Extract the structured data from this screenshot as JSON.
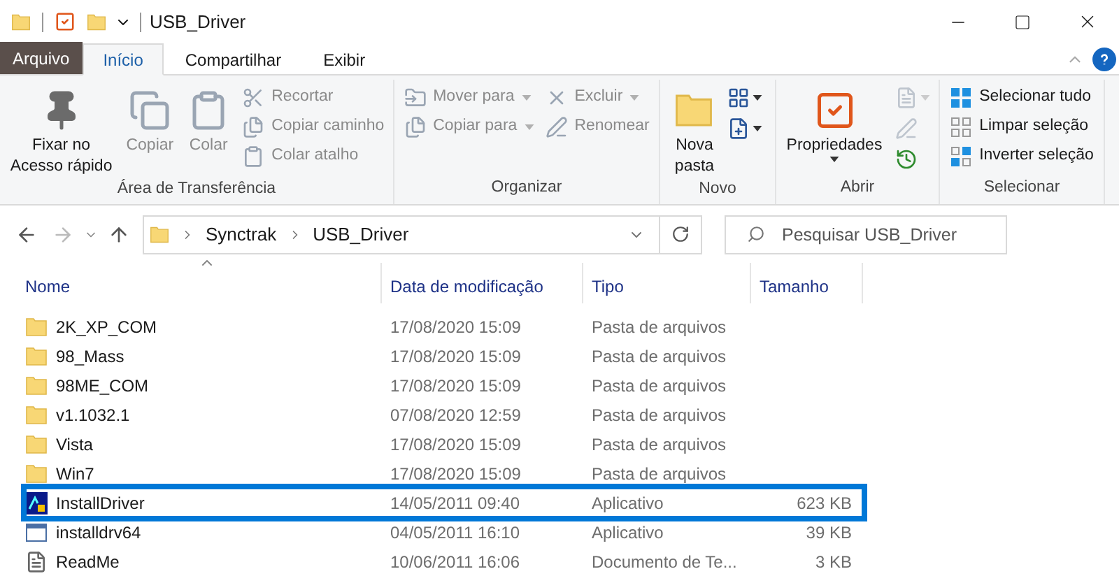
{
  "title_bar": {
    "title": "USB_Driver"
  },
  "ribbon_tabs": [
    {
      "label": "Arquivo",
      "kind": "file",
      "selected": false
    },
    {
      "label": "Início",
      "kind": "tab",
      "selected": true
    },
    {
      "label": "Compartilhar",
      "kind": "tab",
      "selected": false
    },
    {
      "label": "Exibir",
      "kind": "tab",
      "selected": false
    }
  ],
  "ribbon_groups": [
    {
      "label": "Área de Transferência",
      "columns": [
        [
          {
            "kind": "large",
            "label": "Fixar no\nAcesso rápido",
            "disabled": false
          }
        ],
        [
          {
            "kind": "large",
            "label": "Copiar",
            "disabled": true
          }
        ],
        [
          {
            "kind": "large",
            "label": "Colar",
            "disabled": true
          }
        ],
        [
          {
            "kind": "small",
            "label": "Recortar",
            "disabled": true
          },
          {
            "kind": "small",
            "label": "Copiar caminho",
            "disabled": true
          },
          {
            "kind": "small",
            "label": "Colar atalho",
            "disabled": true
          }
        ]
      ]
    },
    {
      "label": "Organizar",
      "columns": [
        [
          {
            "kind": "small",
            "label": "Mover para",
            "disabled": true,
            "dropdown": true
          },
          {
            "kind": "small",
            "label": "Copiar para",
            "disabled": true,
            "dropdown": true
          }
        ],
        [
          {
            "kind": "small",
            "label": "Excluir",
            "disabled": true,
            "dropdown": true
          },
          {
            "kind": "small",
            "label": "Renomear",
            "disabled": true
          }
        ]
      ]
    },
    {
      "label": "Novo",
      "columns": [
        [
          {
            "kind": "large",
            "label": "Nova\npasta",
            "disabled": false
          }
        ],
        [
          {
            "kind": "icon",
            "disabled": false,
            "dropdown": true
          },
          {
            "kind": "icon",
            "disabled": false,
            "dropdown": true
          }
        ]
      ]
    },
    {
      "label": "Abrir",
      "columns": [
        [
          {
            "kind": "large",
            "label": "Propriedades",
            "disabled": false,
            "dropdown": true
          }
        ],
        [
          {
            "kind": "icon",
            "disabled": true,
            "dropdown": true
          },
          {
            "kind": "icon",
            "disabled": true
          },
          {
            "kind": "icon",
            "disabled": false
          }
        ]
      ]
    },
    {
      "label": "Selecionar",
      "columns": [
        [
          {
            "kind": "small",
            "label": "Selecionar tudo",
            "disabled": false
          },
          {
            "kind": "small",
            "label": "Limpar seleção",
            "disabled": false
          },
          {
            "kind": "small",
            "label": "Inverter seleção",
            "disabled": false
          }
        ]
      ]
    }
  ],
  "address_bar": {
    "breadcrumbs": [
      "Synctrak",
      "USB_Driver"
    ]
  },
  "search": {
    "placeholder": "Pesquisar USB_Driver"
  },
  "columns": [
    {
      "label": "Nome",
      "sorted": true
    },
    {
      "label": "Data de modificação",
      "sorted": false
    },
    {
      "label": "Tipo",
      "sorted": false
    },
    {
      "label": "Tamanho",
      "sorted": false
    }
  ],
  "rows": [
    {
      "kind": "folder",
      "name": "2K_XP_COM",
      "date": "17/08/2020 15:09",
      "type": "Pasta de arquivos",
      "highlighted": false
    },
    {
      "kind": "folder",
      "name": "98_Mass",
      "date": "17/08/2020 15:09",
      "type": "Pasta de arquivos",
      "highlighted": false
    },
    {
      "kind": "folder",
      "name": "98ME_COM",
      "date": "17/08/2020 15:09",
      "type": "Pasta de arquivos",
      "highlighted": false
    },
    {
      "kind": "folder",
      "name": "v1.1032.1",
      "date": "07/08/2020 12:59",
      "type": "Pasta de arquivos",
      "highlighted": false
    },
    {
      "kind": "folder",
      "name": "Vista",
      "date": "17/08/2020 15:09",
      "type": "Pasta de arquivos",
      "highlighted": false
    },
    {
      "kind": "folder",
      "name": "Win7",
      "date": "17/08/2020 15:09",
      "type": "Pasta de arquivos",
      "highlighted": false
    },
    {
      "kind": "installer",
      "name": "InstallDriver",
      "date": "14/05/2011 09:40",
      "type": "Aplicativo",
      "size": "623 KB",
      "highlighted": true
    },
    {
      "kind": "app",
      "name": "installdrv64",
      "date": "04/05/2011 16:10",
      "type": "Aplicativo",
      "size": "39 KB",
      "highlighted": false
    },
    {
      "kind": "text",
      "name": "ReadMe",
      "date": "10/06/2011 16:06",
      "type": "Documento de Te...",
      "size": "3 KB",
      "highlighted": false
    }
  ]
}
